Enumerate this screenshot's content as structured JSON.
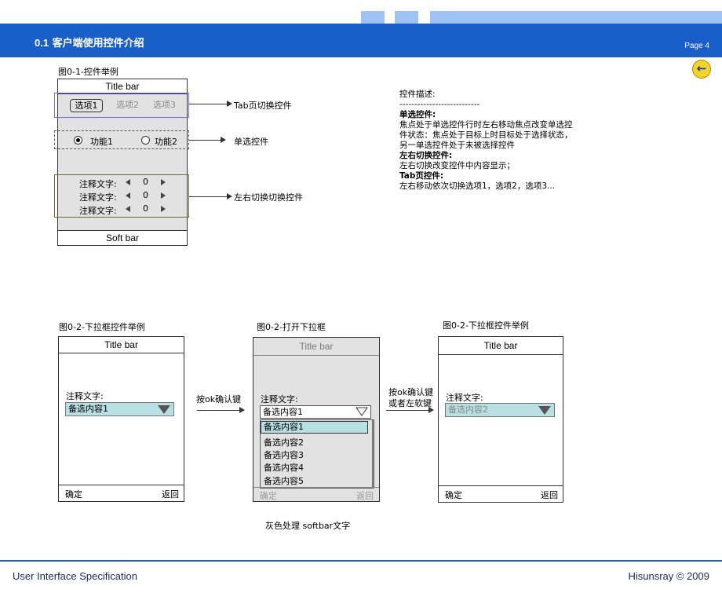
{
  "header": {
    "section_num": "0.1",
    "title": "客户端使用控件介绍",
    "page": "Page 4",
    "back_glyph": "←"
  },
  "colors": {
    "brand": "#1a5fc8",
    "highlight": "#b7dfe4",
    "focus_frame": "#6a6ef0"
  },
  "fig1": {
    "caption": "图0-1-控件举例",
    "title_bar": "Title bar",
    "tabs": [
      "选项1",
      "选项2",
      "选项3"
    ],
    "radio_options": [
      "功能1",
      "功能2"
    ],
    "switch_rows": [
      {
        "label": "注释文字:",
        "value": "0"
      },
      {
        "label": "注释文字:",
        "value": "0"
      },
      {
        "label": "注释文字:",
        "value": "0"
      }
    ],
    "soft_bar": "Soft bar",
    "annotations": {
      "tab": "Tab页切换控件",
      "radio": "单选控件",
      "switch": "左右切换切换控件"
    }
  },
  "description": {
    "title": "控件描述:",
    "divider": "---------------------------",
    "radio_heading": "单选控件:",
    "radio_text": [
      "焦点处于单选控件行时左右移动焦点改变单选控",
      "件状态：焦点处于目标上时目标处于选择状态，",
      "另一单选控件处于未被选择控件"
    ],
    "switch_heading": "左右切换控件:",
    "switch_text": [
      "左右切换改变控件中内容显示；"
    ],
    "tab_heading": "Tab页控件:",
    "tab_text": [
      "左右移动依次切换选项1，选项2，选项3..."
    ]
  },
  "fig2a": {
    "caption": "图0-2-下拉框控件举例",
    "title_bar": "Title bar",
    "label": "注释文字:",
    "selected": "备选内容1",
    "ok": "确定",
    "back": "返回"
  },
  "arrow1": {
    "label": "按ok确认键"
  },
  "fig2b": {
    "caption": "图0-2-打开下拉框",
    "title_bar": "Title bar",
    "label": "注释文字:",
    "selected": "备选内容1",
    "options": [
      "备选内容1",
      "备选内容2",
      "备选内容3",
      "备选内容4",
      "备选内容5"
    ],
    "ok": "确定",
    "back": "返回",
    "note": "灰色处理 softbar文字"
  },
  "arrow2": {
    "label_line1": "按ok确认键",
    "label_line2": "或者左软键"
  },
  "fig2c": {
    "caption": "图0-2-下拉框控件举例",
    "title_bar": "Title bar",
    "label": "注释文字:",
    "selected": "备选内容2",
    "ok": "确定",
    "back": "返回"
  },
  "footer": {
    "left": "User Interface Specification",
    "right": "Hisunsray © 2009"
  }
}
